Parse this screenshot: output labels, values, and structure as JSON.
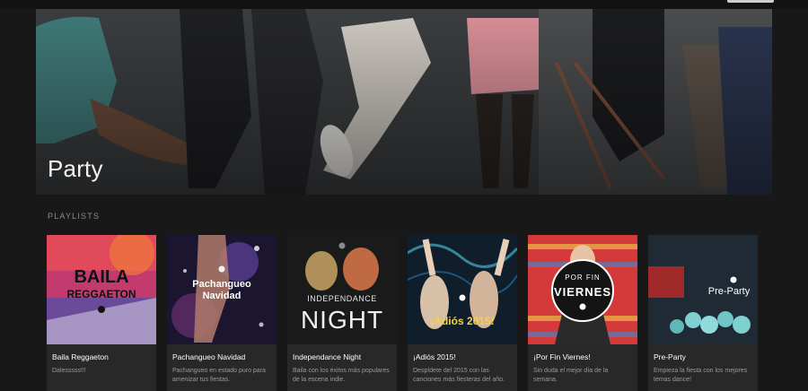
{
  "hero": {
    "title": "Party"
  },
  "section": {
    "label": "PLAYLISTS"
  },
  "playlists": [
    {
      "title": "Baila Reggaeton",
      "description": "Dalesssss!!!",
      "cover_text": [
        "BAILA",
        "REGGAETON"
      ]
    },
    {
      "title": "Pachangueo Navidad",
      "description": "Pachangueo en estado puro para amenizar tus fiestas.",
      "cover_text": [
        "Pachangueo",
        "Navidad"
      ]
    },
    {
      "title": "Independance Night",
      "description": "Baila con los éxitos más populares de la escena indie.",
      "cover_text": [
        "INDEPENDANCE",
        "NIGHT"
      ]
    },
    {
      "title": "¡Adiós 2015!",
      "description": "Despídete del 2015 con las canciones más fiesteras del año.",
      "cover_text": [
        "¡Adiós 2015!"
      ]
    },
    {
      "title": "¡Por Fin Viernes!",
      "description": "Sin duda el mejor día de la semana.",
      "cover_text": [
        "POR FIN",
        "VIERNES"
      ]
    },
    {
      "title": "Pre-Party",
      "description": "Empieza la fiesta con los mejores temas dance!",
      "cover_text": [
        "Pre-Party"
      ]
    }
  ]
}
